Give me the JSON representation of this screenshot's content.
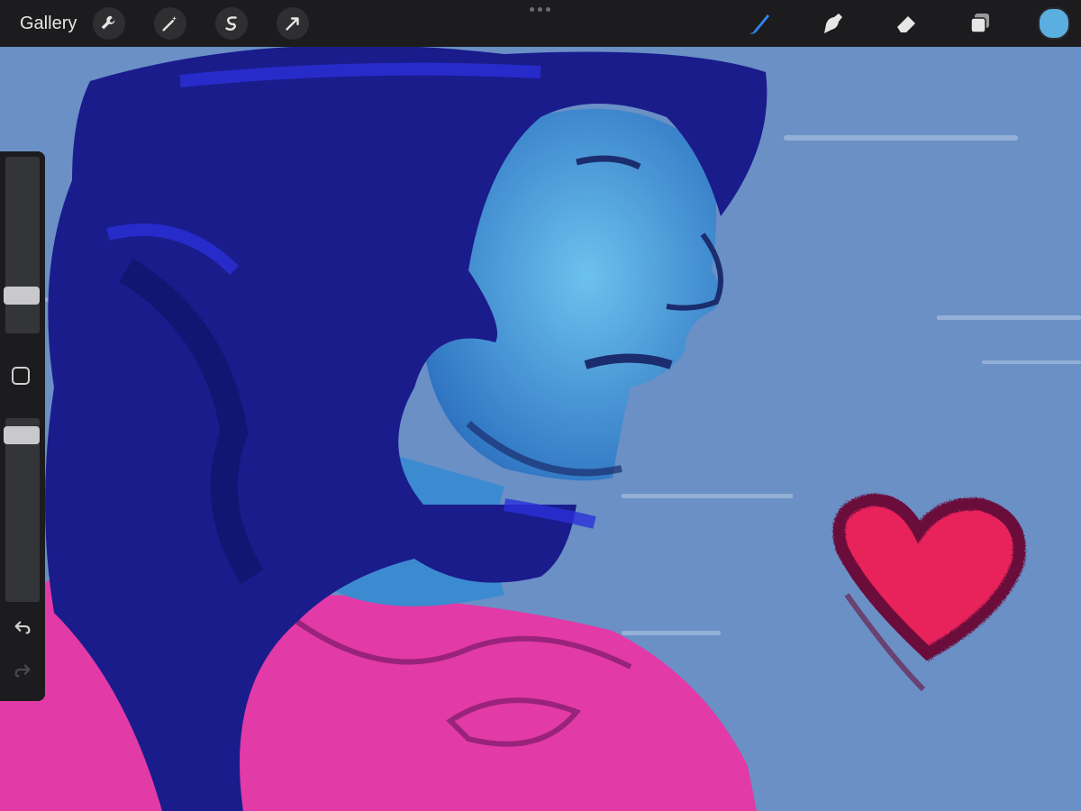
{
  "toolbar": {
    "gallery_label": "Gallery",
    "left_tools": [
      {
        "name": "actions",
        "icon": "wrench-icon"
      },
      {
        "name": "adjustments",
        "icon": "magic-wand-icon"
      },
      {
        "name": "selection",
        "icon": "selection-s-icon"
      },
      {
        "name": "transform",
        "icon": "arrow-cursor-icon"
      }
    ],
    "right_tools": [
      {
        "name": "brush",
        "icon": "brush-icon",
        "active": true
      },
      {
        "name": "smudge",
        "icon": "smudge-icon",
        "active": false
      },
      {
        "name": "eraser",
        "icon": "eraser-icon",
        "active": false
      },
      {
        "name": "layers",
        "icon": "layers-icon",
        "active": false
      }
    ],
    "current_color": "#5aaee0",
    "active_tool_color": "#2f86f0"
  },
  "sidebar": {
    "brush_size": 0.18,
    "brush_opacity": 0.95,
    "modifier_icon": "square-modifier-icon",
    "undo_icon": "undo-icon",
    "redo_icon": "redo-icon"
  },
  "canvas": {
    "background_color": "#6a90c6",
    "hair_color": "#1a1c8c",
    "skin_color": "#3f8fd4",
    "shirt_color": "#e23aa6",
    "heart_fill": "#e8205a",
    "heart_outline": "#6a0f3a"
  }
}
